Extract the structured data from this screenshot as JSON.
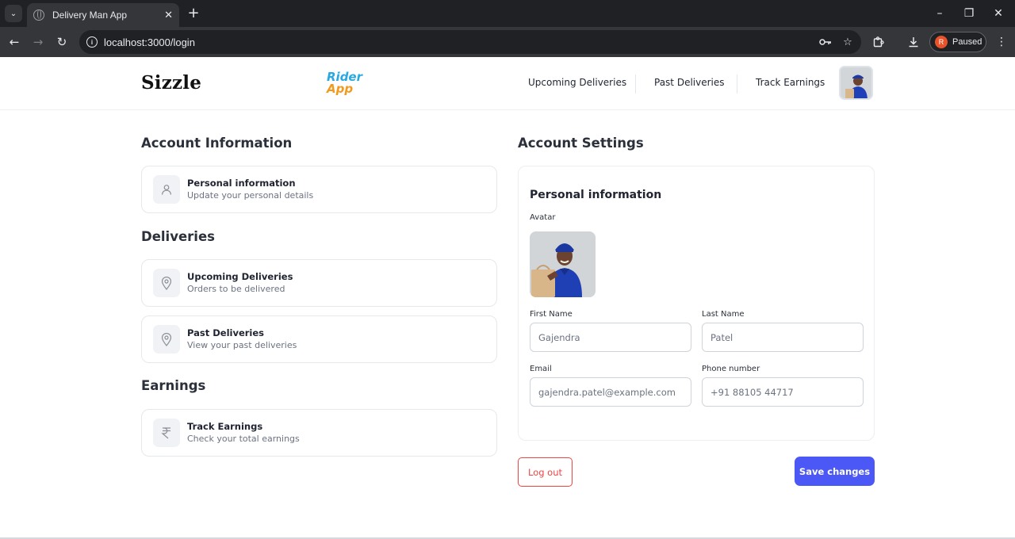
{
  "browser": {
    "tab_title": "Delivery Man App",
    "url": "localhost:3000/login",
    "profile_initial": "R",
    "profile_status": "Paused"
  },
  "header": {
    "brand": "Sizzle",
    "logo_line1": "Rider",
    "logo_line2": "App",
    "nav": [
      "Upcoming Deliveries",
      "Past Deliveries",
      "Track Earnings"
    ]
  },
  "left": {
    "account_title": "Account Information",
    "personal": {
      "title": "Personal information",
      "subtitle": "Update your personal details"
    },
    "deliveries_title": "Deliveries",
    "upcoming": {
      "title": "Upcoming Deliveries",
      "subtitle": "Orders to be delivered"
    },
    "past": {
      "title": "Past Deliveries",
      "subtitle": "View your past deliveries"
    },
    "earnings_title": "Earnings",
    "track": {
      "title": "Track Earnings",
      "subtitle": "Check your total earnings"
    }
  },
  "settings": {
    "title": "Account Settings",
    "panel_heading": "Personal information",
    "avatar_label": "Avatar",
    "first_name_label": "First Name",
    "first_name_placeholder": "Gajendra",
    "last_name_label": "Last Name",
    "last_name_placeholder": "Patel",
    "email_label": "Email",
    "email_placeholder": "gajendra.patel@example.com",
    "phone_label": "Phone number",
    "phone_placeholder": "+91 88105 44717"
  },
  "actions": {
    "logout": "Log out",
    "save": "Save changes"
  },
  "colors": {
    "primary": "#4b58f5",
    "danger": "#ef4444",
    "logo_blue": "#2aa8e0",
    "logo_orange": "#f39a1e"
  }
}
